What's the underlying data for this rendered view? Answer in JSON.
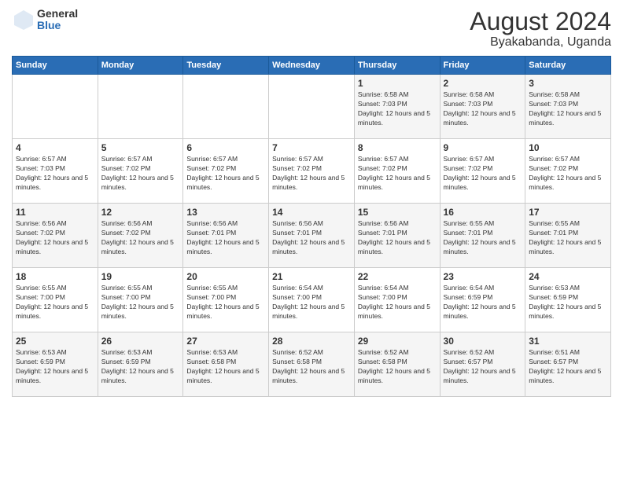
{
  "logo": {
    "general": "General",
    "blue": "Blue"
  },
  "title": "August 2024",
  "subtitle": "Byakabanda, Uganda",
  "days_of_week": [
    "Sunday",
    "Monday",
    "Tuesday",
    "Wednesday",
    "Thursday",
    "Friday",
    "Saturday"
  ],
  "weeks": [
    [
      {
        "num": "",
        "info": ""
      },
      {
        "num": "",
        "info": ""
      },
      {
        "num": "",
        "info": ""
      },
      {
        "num": "",
        "info": ""
      },
      {
        "num": "1",
        "info": "Sunrise: 6:58 AM\nSunset: 7:03 PM\nDaylight: 12 hours and 5 minutes."
      },
      {
        "num": "2",
        "info": "Sunrise: 6:58 AM\nSunset: 7:03 PM\nDaylight: 12 hours and 5 minutes."
      },
      {
        "num": "3",
        "info": "Sunrise: 6:58 AM\nSunset: 7:03 PM\nDaylight: 12 hours and 5 minutes."
      }
    ],
    [
      {
        "num": "4",
        "info": "Sunrise: 6:57 AM\nSunset: 7:03 PM\nDaylight: 12 hours and 5 minutes."
      },
      {
        "num": "5",
        "info": "Sunrise: 6:57 AM\nSunset: 7:02 PM\nDaylight: 12 hours and 5 minutes."
      },
      {
        "num": "6",
        "info": "Sunrise: 6:57 AM\nSunset: 7:02 PM\nDaylight: 12 hours and 5 minutes."
      },
      {
        "num": "7",
        "info": "Sunrise: 6:57 AM\nSunset: 7:02 PM\nDaylight: 12 hours and 5 minutes."
      },
      {
        "num": "8",
        "info": "Sunrise: 6:57 AM\nSunset: 7:02 PM\nDaylight: 12 hours and 5 minutes."
      },
      {
        "num": "9",
        "info": "Sunrise: 6:57 AM\nSunset: 7:02 PM\nDaylight: 12 hours and 5 minutes."
      },
      {
        "num": "10",
        "info": "Sunrise: 6:57 AM\nSunset: 7:02 PM\nDaylight: 12 hours and 5 minutes."
      }
    ],
    [
      {
        "num": "11",
        "info": "Sunrise: 6:56 AM\nSunset: 7:02 PM\nDaylight: 12 hours and 5 minutes."
      },
      {
        "num": "12",
        "info": "Sunrise: 6:56 AM\nSunset: 7:02 PM\nDaylight: 12 hours and 5 minutes."
      },
      {
        "num": "13",
        "info": "Sunrise: 6:56 AM\nSunset: 7:01 PM\nDaylight: 12 hours and 5 minutes."
      },
      {
        "num": "14",
        "info": "Sunrise: 6:56 AM\nSunset: 7:01 PM\nDaylight: 12 hours and 5 minutes."
      },
      {
        "num": "15",
        "info": "Sunrise: 6:56 AM\nSunset: 7:01 PM\nDaylight: 12 hours and 5 minutes."
      },
      {
        "num": "16",
        "info": "Sunrise: 6:55 AM\nSunset: 7:01 PM\nDaylight: 12 hours and 5 minutes."
      },
      {
        "num": "17",
        "info": "Sunrise: 6:55 AM\nSunset: 7:01 PM\nDaylight: 12 hours and 5 minutes."
      }
    ],
    [
      {
        "num": "18",
        "info": "Sunrise: 6:55 AM\nSunset: 7:00 PM\nDaylight: 12 hours and 5 minutes."
      },
      {
        "num": "19",
        "info": "Sunrise: 6:55 AM\nSunset: 7:00 PM\nDaylight: 12 hours and 5 minutes."
      },
      {
        "num": "20",
        "info": "Sunrise: 6:55 AM\nSunset: 7:00 PM\nDaylight: 12 hours and 5 minutes."
      },
      {
        "num": "21",
        "info": "Sunrise: 6:54 AM\nSunset: 7:00 PM\nDaylight: 12 hours and 5 minutes."
      },
      {
        "num": "22",
        "info": "Sunrise: 6:54 AM\nSunset: 7:00 PM\nDaylight: 12 hours and 5 minutes."
      },
      {
        "num": "23",
        "info": "Sunrise: 6:54 AM\nSunset: 6:59 PM\nDaylight: 12 hours and 5 minutes."
      },
      {
        "num": "24",
        "info": "Sunrise: 6:53 AM\nSunset: 6:59 PM\nDaylight: 12 hours and 5 minutes."
      }
    ],
    [
      {
        "num": "25",
        "info": "Sunrise: 6:53 AM\nSunset: 6:59 PM\nDaylight: 12 hours and 5 minutes."
      },
      {
        "num": "26",
        "info": "Sunrise: 6:53 AM\nSunset: 6:59 PM\nDaylight: 12 hours and 5 minutes."
      },
      {
        "num": "27",
        "info": "Sunrise: 6:53 AM\nSunset: 6:58 PM\nDaylight: 12 hours and 5 minutes."
      },
      {
        "num": "28",
        "info": "Sunrise: 6:52 AM\nSunset: 6:58 PM\nDaylight: 12 hours and 5 minutes."
      },
      {
        "num": "29",
        "info": "Sunrise: 6:52 AM\nSunset: 6:58 PM\nDaylight: 12 hours and 5 minutes."
      },
      {
        "num": "30",
        "info": "Sunrise: 6:52 AM\nSunset: 6:57 PM\nDaylight: 12 hours and 5 minutes."
      },
      {
        "num": "31",
        "info": "Sunrise: 6:51 AM\nSunset: 6:57 PM\nDaylight: 12 hours and 5 minutes."
      }
    ]
  ]
}
